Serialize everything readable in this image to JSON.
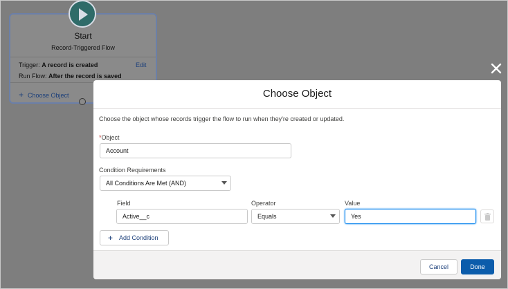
{
  "start_node": {
    "title": "Start",
    "subtitle": "Record-Triggered Flow",
    "trigger_label": "Trigger:",
    "trigger_value": "A record is created",
    "run_flow_label": "Run Flow:",
    "run_flow_value": "After the record is saved",
    "edit_label": "Edit",
    "choose_object_label": "Choose Object"
  },
  "modal": {
    "title": "Choose Object",
    "description": "Choose the object whose records trigger the flow to run when they're created or updated.",
    "object_label": "Object",
    "object_required_marker": "*",
    "object_value": "Account",
    "condition_requirements_label": "Condition Requirements",
    "condition_requirements_value": "All Conditions Are Met (AND)",
    "condition": {
      "field_label": "Field",
      "field_value": "Active__c",
      "operator_label": "Operator",
      "operator_value": "Equals",
      "value_label": "Value",
      "value_value": "Yes"
    },
    "add_condition_label": "Add Condition",
    "cancel_label": "Cancel",
    "done_label": "Done"
  },
  "icons": {
    "close": "close-icon",
    "play": "play-icon",
    "trash": "trash-icon",
    "plus": "plus-icon"
  },
  "colors": {
    "overlay": "#7e7e7e",
    "brand": "#0b5cab",
    "start_circle": "#2f6b69",
    "link": "#1b3f7a"
  }
}
